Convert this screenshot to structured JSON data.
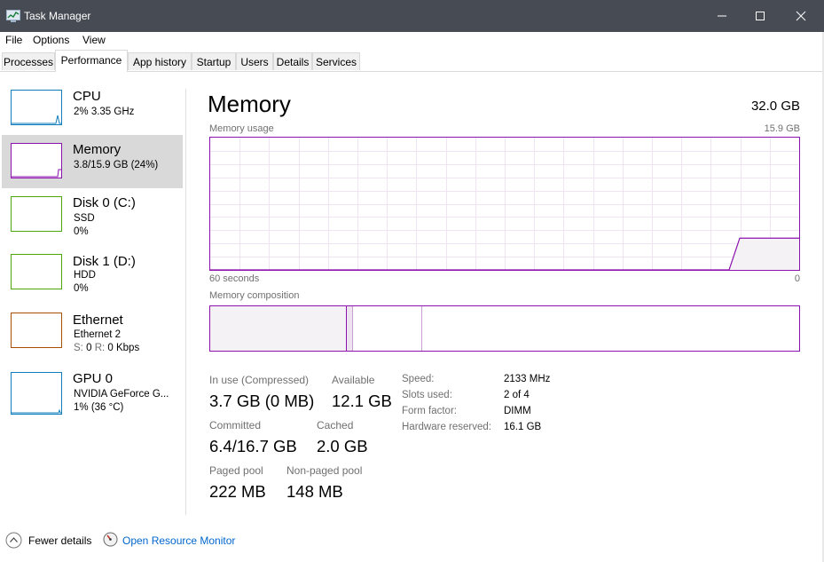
{
  "window": {
    "title": "Task Manager"
  },
  "menu": {
    "file": "File",
    "options": "Options",
    "view": "View"
  },
  "tabs": [
    "Processes",
    "Performance",
    "App history",
    "Startup",
    "Users",
    "Details",
    "Services"
  ],
  "active_tab": "Performance",
  "sidebar": {
    "items": [
      {
        "name": "CPU",
        "line1": "2%  3.35 GHz",
        "line2": "",
        "color": "#117dbb"
      },
      {
        "name": "Memory",
        "line1": "3.8/15.9 GB (24%)",
        "line2": "",
        "color": "#8b12ae"
      },
      {
        "name": "Disk 0 (C:)",
        "line1": "SSD",
        "line2": "0%",
        "color": "#4da60c"
      },
      {
        "name": "Disk 1 (D:)",
        "line1": "HDD",
        "line2": "0%",
        "color": "#4da60c"
      },
      {
        "name": "Ethernet",
        "line1": "Ethernet 2",
        "line2_prefix_s": "S:",
        "line2_s": "0",
        "line2_prefix_r": "R:",
        "line2_r": "0 Kbps",
        "color": "#a74f01"
      },
      {
        "name": "GPU 0",
        "line1": "NVIDIA GeForce G...",
        "line2": "1%  (36 °C)",
        "color": "#117dbb"
      }
    ]
  },
  "main": {
    "title": "Memory",
    "total": "32.0 GB",
    "usage_label": "Memory usage",
    "usage_max": "15.9 GB",
    "axis_left": "60 seconds",
    "axis_right": "0",
    "composition_label": "Memory composition",
    "usage_fraction": 0.24,
    "stats": {
      "in_use_label": "In use (Compressed)",
      "in_use_value": "3.7 GB (0 MB)",
      "available_label": "Available",
      "available_value": "12.1 GB",
      "committed_label": "Committed",
      "committed_value": "6.4/16.7 GB",
      "cached_label": "Cached",
      "cached_value": "2.0 GB",
      "paged_label": "Paged pool",
      "paged_value": "222 MB",
      "nonpaged_label": "Non-paged pool",
      "nonpaged_value": "148 MB"
    },
    "details": {
      "speed_label": "Speed:",
      "speed_value": "2133 MHz",
      "slots_label": "Slots used:",
      "slots_value": "2 of 4",
      "form_label": "Form factor:",
      "form_value": "DIMM",
      "hw_label": "Hardware reserved:",
      "hw_value": "16.1 GB"
    }
  },
  "footer": {
    "fewer_details": "Fewer details",
    "open_resource_monitor": "Open Resource Monitor"
  },
  "colors": {
    "memory_accent": "#8b12ae",
    "memory_fill": "#f4f2f4",
    "titlebar": "#474b53",
    "link": "#0066cc"
  }
}
